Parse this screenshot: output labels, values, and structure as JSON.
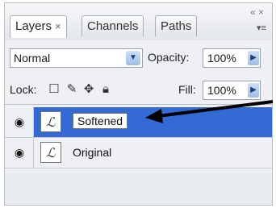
{
  "tabs": [
    {
      "label": "Layers",
      "close": "×"
    },
    {
      "label": "Channels"
    },
    {
      "label": "Paths"
    }
  ],
  "window_controls": "« ×",
  "panel_menu_icon": "menu-icon",
  "blend_mode": {
    "value": "Normal"
  },
  "opacity": {
    "label": "Opacity:",
    "value": "100%"
  },
  "lock": {
    "label": "Lock:"
  },
  "fill": {
    "label": "Fill:",
    "value": "100%"
  },
  "layers": [
    {
      "name": "Softened",
      "selected": true,
      "visible": true
    },
    {
      "name": "Original",
      "selected": false,
      "visible": true
    }
  ],
  "colors": {
    "selection": "#3569d3",
    "annotation_arrow": "#000000"
  }
}
